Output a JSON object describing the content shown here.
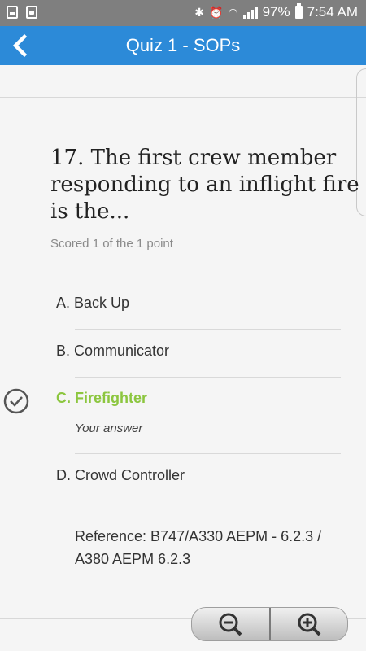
{
  "status_bar": {
    "left_icons": [
      "image-icon",
      "save-icon"
    ],
    "bluetooth": "bluetooth-icon",
    "alarm": "alarm-icon",
    "wifi": "wifi-icon",
    "signal": "signal-icon",
    "battery_percent": "97%",
    "time": "7:54 AM"
  },
  "app_bar": {
    "back_icon": "back-arrow-icon",
    "title": "Quiz 1 - SOPs",
    "color": "#2c8ad8"
  },
  "question": {
    "text": "17. The first crew member responding to an inflight fire is the...",
    "score": "Scored 1 of the 1 point"
  },
  "options": [
    {
      "label": "A. Back Up"
    },
    {
      "label": "B. Communicator"
    },
    {
      "label": "C. Firefighter",
      "selected": true,
      "note": "Your answer",
      "color": "#8cc63f"
    },
    {
      "label": "D. Crowd Controller"
    }
  ],
  "reference": "Reference: B747/A330 AEPM - 6.2.3 / A380 AEPM 6.2.3",
  "zoom_controls": {
    "zoom_out_icon": "zoom-out-icon",
    "zoom_in_icon": "zoom-in-icon"
  }
}
